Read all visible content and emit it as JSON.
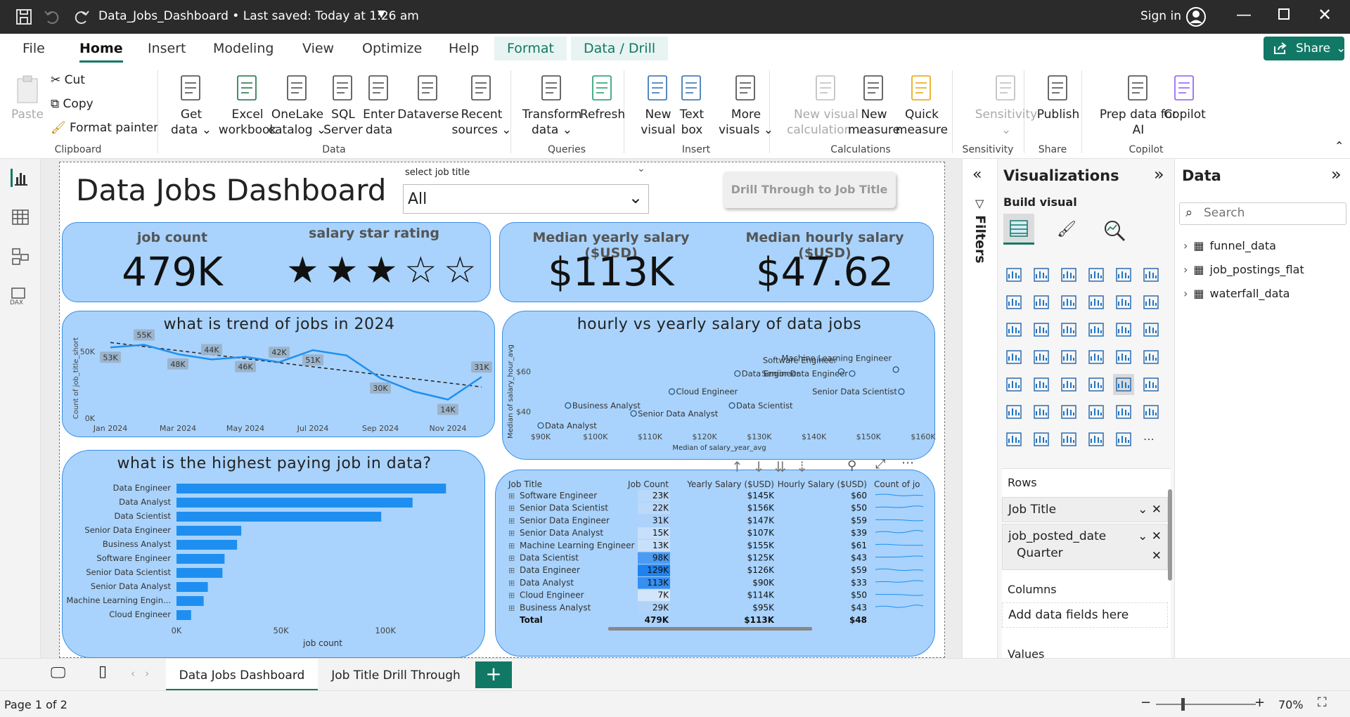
{
  "titlebar": {
    "doc_title": "Data_Jobs_Dashboard • Last saved: Today at 1:26 am",
    "sign_in": "Sign in"
  },
  "menu": {
    "tabs": [
      "File",
      "Home",
      "Insert",
      "Modeling",
      "View",
      "Optimize",
      "Help",
      "Format",
      "Data / Drill"
    ],
    "share": "Share"
  },
  "ribbon": {
    "clipboard": {
      "paste": "Paste",
      "cut": "Cut",
      "copy": "Copy",
      "format_painter": "Format painter",
      "group": "Clipboard"
    },
    "data": {
      "group": "Data",
      "buttons": [
        [
          "Get",
          "data ⌄"
        ],
        [
          "Excel",
          "workbook"
        ],
        [
          "OneLake",
          "catalog ⌄"
        ],
        [
          "SQL",
          "Server"
        ],
        [
          "Enter",
          "data"
        ],
        [
          "Dataverse",
          ""
        ],
        [
          "Recent",
          "sources ⌄"
        ]
      ]
    },
    "queries": {
      "group": "Queries",
      "buttons": [
        [
          "Transform",
          "data ⌄"
        ],
        [
          "Refresh",
          ""
        ]
      ]
    },
    "insert": {
      "group": "Insert",
      "buttons": [
        [
          "New",
          "visual"
        ],
        [
          "Text",
          "box"
        ],
        [
          "More",
          "visuals ⌄"
        ]
      ]
    },
    "calculations": {
      "group": "Calculations",
      "buttons": [
        [
          "New visual",
          "calculation ⌄"
        ],
        [
          "New",
          "measure"
        ],
        [
          "Quick",
          "measure"
        ]
      ]
    },
    "sensitivity": {
      "group": "Sensitivity",
      "buttons": [
        [
          "Sensitivity",
          "⌄"
        ]
      ]
    },
    "share": {
      "group": "Share",
      "buttons": [
        [
          "Publish",
          ""
        ]
      ]
    },
    "copilot": {
      "group": "Copilot",
      "buttons": [
        [
          "Prep data for",
          "AI"
        ],
        [
          "Copilot",
          ""
        ]
      ]
    }
  },
  "dashboard": {
    "title": "Data Jobs Dashboard",
    "slicer": {
      "label": "select job title",
      "value": "All"
    },
    "drill_button": "Drill Through to Job Title",
    "kpis": {
      "job_count_label": "job count",
      "job_count": "479K",
      "rating_label": "salary star rating",
      "rating": 3,
      "rating_max": 5,
      "median_yearly_label": "Median yearly salary ($USD)",
      "median_yearly": "$113K",
      "median_hourly_label": "Median hourly salary ($USD)",
      "median_hourly": "$47.62"
    },
    "trend_title": "what is trend of jobs in 2024",
    "scatter_title": "hourly vs yearly salary of data jobs",
    "bar_title": "what is the highest paying job in data?"
  },
  "chart_data": [
    {
      "type": "line",
      "title": "what is trend of jobs in 2024",
      "ylabel": "Count of job_title_short",
      "xlabel": "",
      "x": [
        "Jan 2024",
        "Feb 2024",
        "Mar 2024",
        "Apr 2024",
        "May 2024",
        "Jun 2024",
        "Jul 2024",
        "Aug 2024",
        "Sep 2024",
        "Oct 2024",
        "Nov 2024",
        "Dec 2024"
      ],
      "x_ticks": [
        "Jan 2024",
        "Mar 2024",
        "May 2024",
        "Jul 2024",
        "Sep 2024",
        "Nov 2024"
      ],
      "y": [
        53,
        55,
        48,
        44,
        46,
        42,
        51,
        47,
        30,
        20,
        14,
        31
      ],
      "data_labels": [
        "53K",
        "55K",
        "48K",
        "44K",
        "46K",
        "42K",
        "51K",
        "",
        "30K",
        "",
        "14K",
        "31K"
      ],
      "y_ticks": [
        "0K",
        "50K"
      ],
      "ylim": [
        0,
        60
      ],
      "trendline": true
    },
    {
      "type": "scatter",
      "title": "hourly vs yearly salary of data jobs",
      "xlabel": "Median of salary_year_avg",
      "ylabel": "Median of salary_hour_avg",
      "x_ticks": [
        "$90K",
        "$100K",
        "$110K",
        "$120K",
        "$130K",
        "$140K",
        "$150K",
        "$160K"
      ],
      "y_ticks": [
        "$40",
        "$60"
      ],
      "xlim": [
        90,
        160
      ],
      "ylim": [
        31,
        69
      ],
      "points": [
        {
          "label": "Data Analyst",
          "x": 90,
          "y": 33
        },
        {
          "label": "Business Analyst",
          "x": 95,
          "y": 43
        },
        {
          "label": "Senior Data Analyst",
          "x": 107,
          "y": 39
        },
        {
          "label": "Cloud Engineer",
          "x": 114,
          "y": 50
        },
        {
          "label": "Data Scientist",
          "x": 125,
          "y": 43
        },
        {
          "label": "Data Engineer",
          "x": 126,
          "y": 59
        },
        {
          "label": "Senior Data Engineer",
          "x": 147,
          "y": 59
        },
        {
          "label": "Machine Learning Engineer",
          "x": 155,
          "y": 61
        },
        {
          "label": "Software Engineer",
          "x": 145,
          "y": 60
        },
        {
          "label": "Senior Data Scientist",
          "x": 156,
          "y": 50
        }
      ]
    },
    {
      "type": "bar",
      "orientation": "horizontal",
      "title": "what is the highest paying job in data?",
      "xlabel": "job count",
      "x_ticks": [
        "0K",
        "50K",
        "100K"
      ],
      "xlim": [
        0,
        140
      ],
      "categories": [
        "Data Engineer",
        "Data Analyst",
        "Data Scientist",
        "Senior Data Engineer",
        "Business Analyst",
        "Software Engineer",
        "Senior Data Scientist",
        "Senior Data Analyst",
        "Machine Learning Engin...",
        "Cloud Engineer"
      ],
      "values": [
        129,
        113,
        98,
        31,
        29,
        23,
        22,
        15,
        13,
        7
      ]
    },
    {
      "type": "table",
      "columns": [
        "Job Title",
        "Job Count",
        "Yearly Salary ($USD)",
        "Hourly Salary ($USD)",
        "Count of jo"
      ],
      "rows": [
        [
          "Software Engineer",
          "23K",
          "$145K",
          "$60"
        ],
        [
          "Senior Data Scientist",
          "22K",
          "$156K",
          "$50"
        ],
        [
          "Senior Data Engineer",
          "31K",
          "$147K",
          "$59"
        ],
        [
          "Senior Data Analyst",
          "15K",
          "$107K",
          "$39"
        ],
        [
          "Machine Learning Engineer",
          "13K",
          "$155K",
          "$61"
        ],
        [
          "Data Scientist",
          "98K",
          "$125K",
          "$43"
        ],
        [
          "Data Engineer",
          "129K",
          "$126K",
          "$59"
        ],
        [
          "Data Analyst",
          "113K",
          "$90K",
          "$33"
        ],
        [
          "Cloud Engineer",
          "7K",
          "$114K",
          "$50"
        ],
        [
          "Business Analyst",
          "29K",
          "$95K",
          "$43"
        ]
      ],
      "job_count_values": [
        23,
        22,
        31,
        15,
        13,
        98,
        129,
        113,
        7,
        29
      ],
      "total": [
        "Total",
        "479K",
        "$113K",
        "$48"
      ]
    }
  ],
  "filters": {
    "label": "Filters"
  },
  "visualizations": {
    "title": "Visualizations",
    "build": "Build visual",
    "rows_label": "Rows",
    "row_fields": [
      "Job Title",
      "job_posted_date",
      "Quarter"
    ],
    "columns_label": "Columns",
    "columns_placeholder": "Add data fields here",
    "values_label": "Values"
  },
  "data_pane": {
    "title": "Data",
    "search_placeholder": "Search",
    "tables": [
      "funnel_data",
      "job_postings_flat",
      "waterfall_data"
    ]
  },
  "pages": {
    "tabs": [
      "Data Jobs Dashboard",
      "Job Title Drill Through"
    ],
    "add": "+"
  },
  "status": {
    "page": "Page 1 of 2",
    "zoom": "70%"
  },
  "colors": {
    "accent": "#117865",
    "card": "#a9d3fc",
    "series": "#1e8ff0"
  }
}
